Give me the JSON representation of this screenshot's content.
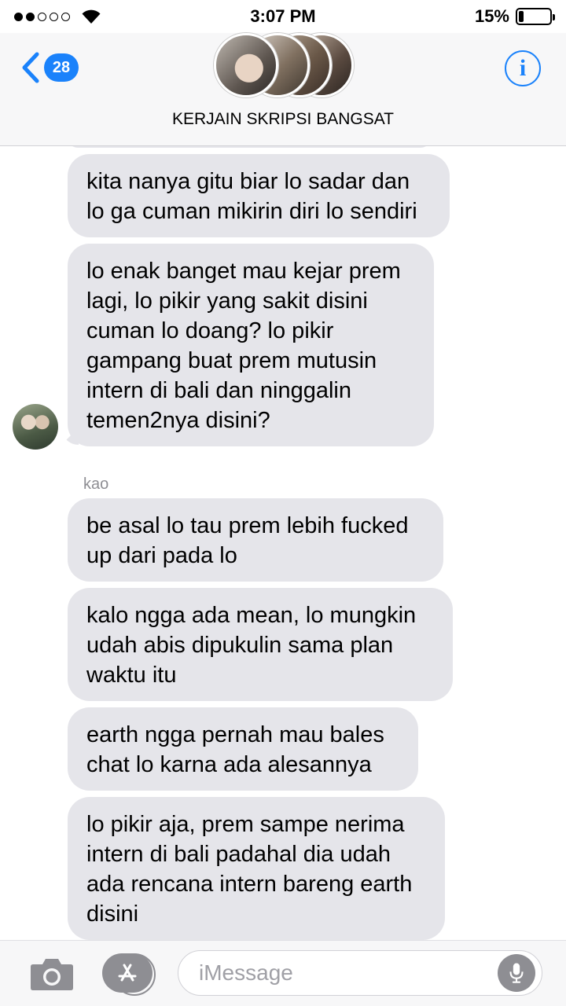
{
  "status_bar": {
    "time": "3:07 PM",
    "battery_percent": "15%",
    "battery_level": 0.15,
    "signal_bars_filled": 2,
    "signal_bars_total": 5
  },
  "header": {
    "back_count": "28",
    "group_title": "KERJAIN SKRIPSI BANGSAT",
    "info_glyph": "i"
  },
  "messages": [
    {
      "text": "kita nanya gitu biar lo sadar dan lo ga cuman mikirin diri lo sendiri"
    },
    {
      "text": "lo enak banget mau kejar prem lagi, lo pikir yang sakit disini cuman lo doang? lo pikir gampang buat prem mutusin intern di bali dan ninggalin temen2nya disini?"
    },
    {
      "sender": "kao"
    },
    {
      "text": "be asal lo tau prem lebih fucked up dari pada lo"
    },
    {
      "text": "kalo ngga ada mean, lo mungkin udah abis dipukulin sama plan waktu itu"
    },
    {
      "text": "earth ngga pernah mau bales chat lo karna ada alesannya"
    },
    {
      "text": "lo pikir aja, prem sampe nerima intern di bali padahal dia udah ada rencana intern bareng earth disini"
    }
  ],
  "input": {
    "placeholder": "iMessage"
  },
  "icons": {
    "back": "chevron-left-icon",
    "info": "info-icon",
    "camera": "camera-icon",
    "apps": "app-store-icon",
    "mic": "microphone-icon",
    "wifi": "wifi-icon",
    "battery": "battery-icon"
  },
  "colors": {
    "accent": "#1a82fb",
    "bubble_gray": "#e5e5ea",
    "secondary_text": "#8e8e93"
  }
}
